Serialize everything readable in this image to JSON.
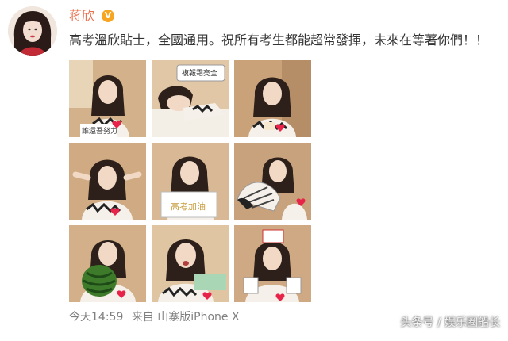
{
  "user": {
    "name": "蒋欣",
    "verified_mark": "V"
  },
  "post": {
    "text": "高考溫欣貼士，全國通用。祝所有考生都能超常發揮，未來在等著你們！！",
    "photos": [
      {
        "sign": "",
        "sign_bottom": "誰還吾努力"
      },
      {
        "sign": "複報霜亮全",
        "sign_bottom": ""
      },
      {
        "sign": "",
        "sign_bottom": ""
      },
      {
        "sign": "",
        "sign_bottom": ""
      },
      {
        "sign": "高考加油",
        "sign_bottom": ""
      },
      {
        "sign": "",
        "sign_bottom": ""
      },
      {
        "sign": "",
        "sign_bottom": ""
      },
      {
        "sign": "",
        "sign_bottom": ""
      },
      {
        "sign": "",
        "sign_bottom": ""
      }
    ],
    "time": "今天14:59",
    "source_prefix": "来自",
    "source": "山寨版iPhone X"
  },
  "watermark": "头条号 / 娱乐圈船长",
  "colors": {
    "username": "#eb7350",
    "verified": "#f6a623",
    "meta": "#808080"
  }
}
